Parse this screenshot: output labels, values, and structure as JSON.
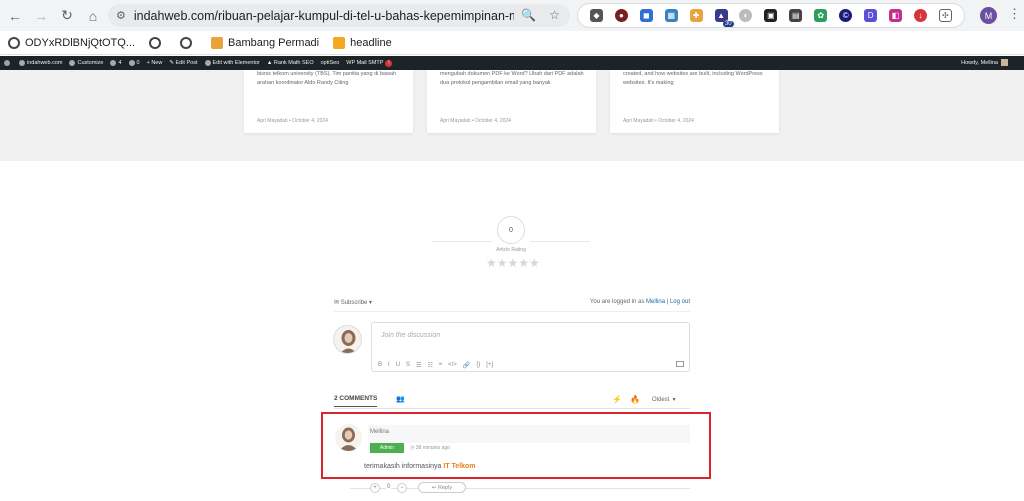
{
  "browser": {
    "url": "indahweb.com/ribuan-pelajar-kumpul-di-tel-u-bahas-kepemimpinan-masa-depan/",
    "profile_initial": "M",
    "ext_badge": "30"
  },
  "bookmarks": [
    {
      "label": "ODYxRDlBNjQtOTQ...",
      "icon_color": "#444"
    },
    {
      "label": "",
      "icon_color": "#444"
    },
    {
      "label": "",
      "icon_color": "#444"
    },
    {
      "label": "Bambang Permadi",
      "icon_color": "#e8a33d"
    },
    {
      "label": "headline",
      "icon_color": "#f5a623"
    }
  ],
  "adminbar": {
    "site": "indahweb.com",
    "customize": "Customize",
    "updates": "4",
    "comments": "0",
    "new": "New",
    "edit_post": "Edit Post",
    "elementor": "Edit with Elementor",
    "rank_math": "Rank Math SEO",
    "optiseo": "optiSeo",
    "wp_mail": "WP Mail SMTP",
    "wp_mail_badge": "!",
    "howdy": "Howdy, Mellina"
  },
  "related": [
    {
      "excerpt": "bisnis telkom university (TBS). Tim panitia  yang di bawah arahan koordinator Aldo Randy Citing",
      "meta": "Apri Mayadati   •   October 4, 2024"
    },
    {
      "excerpt": "mengubah dokumen PDF ke Word? Ubah dari PDF adalah dua protokol pengambilan email yang banyak",
      "meta": "Apri Mayadati   •   October 4, 2024"
    },
    {
      "excerpt": "created, and how websites are built, including WordPress websites. It's making",
      "meta": "Apri Mayadati   •   October 4, 2024"
    }
  ],
  "rating": {
    "value": "0",
    "label": "Article Rating",
    "stars": "★★★★★"
  },
  "comments": {
    "subscribe_label": "Subscribe",
    "logged_in_prefix": "You are logged in as",
    "user": "Mellina",
    "separator": "|",
    "logout": "Log out",
    "placeholder": "Join the discussion",
    "toolbar": [
      "B",
      "I",
      "U",
      "S",
      "☰",
      "☷",
      "❝",
      "</>",
      "🔗",
      "{}",
      "[+]"
    ],
    "count_label": "2 COMMENTS",
    "sort_label": "Oldest",
    "item": {
      "author": "Mellina",
      "role": "Admin",
      "time": "38 minutes ago",
      "text_prefix": "terimakasih informasinya",
      "text_strong": "IT Telkom",
      "vote_count": "0",
      "reply": "Reply"
    }
  }
}
